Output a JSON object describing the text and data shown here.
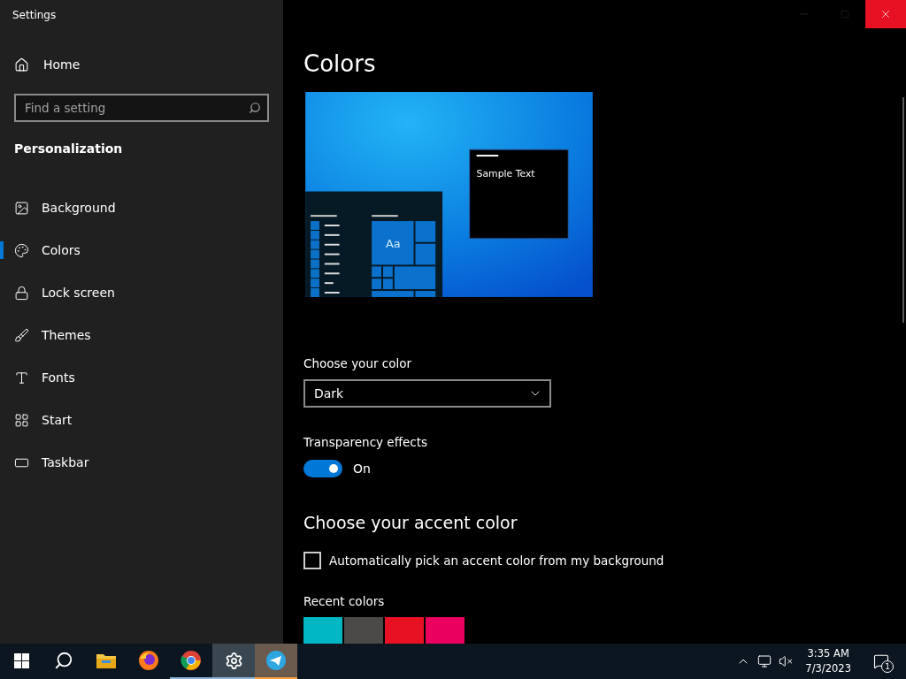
{
  "window": {
    "title": "Settings",
    "controls": [
      {
        "kind": "minimize",
        "hovered": false
      },
      {
        "kind": "maximize",
        "hovered": false
      },
      {
        "kind": "close",
        "hovered": true
      }
    ]
  },
  "sidebar": {
    "home": "Home",
    "search": {
      "placeholder": "Find a setting"
    },
    "section": "Personalization",
    "items": [
      {
        "label": "Background",
        "kind": "image",
        "selected": false
      },
      {
        "label": "Colors",
        "kind": "palette",
        "selected": true
      },
      {
        "label": "Lock screen",
        "kind": "lock",
        "selected": false
      },
      {
        "label": "Themes",
        "kind": "brush",
        "selected": false
      },
      {
        "label": "Fonts",
        "kind": "font",
        "selected": false
      },
      {
        "label": "Start",
        "kind": "tiles",
        "selected": false
      },
      {
        "label": "Taskbar",
        "kind": "bar",
        "selected": false
      }
    ]
  },
  "page": {
    "title": "Colors",
    "preview": {
      "sample_text": "Sample Text",
      "tile_text": "Aa"
    },
    "color_mode": {
      "label": "Choose your color",
      "value": "Dark"
    },
    "transparency": {
      "label": "Transparency effects",
      "on": true,
      "state_label": "On"
    },
    "accent_heading": "Choose your accent color",
    "auto_pick": {
      "label": "Automatically pick an accent color from my background",
      "checked": false
    },
    "recent_colors": {
      "label": "Recent colors",
      "colors": [
        {
          "color": "#00b7c3"
        },
        {
          "color": "#4c4a48"
        },
        {
          "color": "#e81123"
        },
        {
          "color": "#ea005e"
        }
      ]
    }
  },
  "taskbar": {
    "apps": [
      {
        "kind": "start",
        "selected": false,
        "running": false,
        "flashing": false
      },
      {
        "kind": "search",
        "selected": false,
        "running": false,
        "flashing": false
      },
      {
        "kind": "folder",
        "selected": false,
        "running": false,
        "flashing": false
      },
      {
        "kind": "firefox",
        "selected": false,
        "running": false,
        "flashing": false
      },
      {
        "kind": "chrome",
        "selected": false,
        "running": true,
        "flashing": false
      },
      {
        "kind": "settings",
        "selected": true,
        "running": true,
        "flashing": false
      },
      {
        "kind": "telegram",
        "selected": false,
        "running": true,
        "flashing": true
      }
    ],
    "time": "3:35 AM",
    "date": "7/3/2023",
    "notifications": "1"
  }
}
